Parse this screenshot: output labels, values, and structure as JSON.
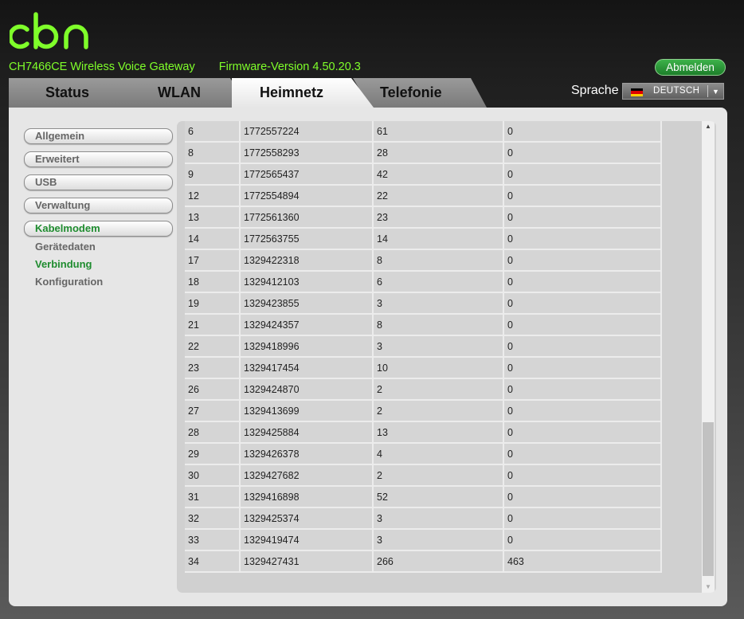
{
  "brand": {
    "logo_alt": "cbn",
    "logo_color": "#7fff2a"
  },
  "header": {
    "model": "CH7466CE  Wireless Voice Gateway",
    "firmware": "Firmware-Version  4.50.20.3",
    "logout_label": "Abmelden"
  },
  "tabs": [
    {
      "label": "Status",
      "active": false
    },
    {
      "label": "WLAN",
      "active": false
    },
    {
      "label": "Heimnetz",
      "active": true
    },
    {
      "label": "Telefonie",
      "active": false
    }
  ],
  "language": {
    "label": "Sprache",
    "selected": "DEUTSCH",
    "flag": "de-flag-icon"
  },
  "sidebar": {
    "items": [
      {
        "label": "Allgemein"
      },
      {
        "label": "Erweitert"
      },
      {
        "label": "USB"
      },
      {
        "label": "Verwaltung"
      },
      {
        "label": "Kabelmodem"
      }
    ],
    "subitems": [
      {
        "label": "Gerätedaten"
      },
      {
        "label": "Verbindung"
      },
      {
        "label": "Konfiguration"
      }
    ]
  },
  "table": {
    "rows": [
      [
        "6",
        "1772557224",
        "61",
        "0"
      ],
      [
        "8",
        "1772558293",
        "28",
        "0"
      ],
      [
        "9",
        "1772565437",
        "42",
        "0"
      ],
      [
        "12",
        "1772554894",
        "22",
        "0"
      ],
      [
        "13",
        "1772561360",
        "23",
        "0"
      ],
      [
        "14",
        "1772563755",
        "14",
        "0"
      ],
      [
        "17",
        "1329422318",
        "8",
        "0"
      ],
      [
        "18",
        "1329412103",
        "6",
        "0"
      ],
      [
        "19",
        "1329423855",
        "3",
        "0"
      ],
      [
        "21",
        "1329424357",
        "8",
        "0"
      ],
      [
        "22",
        "1329418996",
        "3",
        "0"
      ],
      [
        "23",
        "1329417454",
        "10",
        "0"
      ],
      [
        "26",
        "1329424870",
        "2",
        "0"
      ],
      [
        "27",
        "1329413699",
        "2",
        "0"
      ],
      [
        "28",
        "1329425884",
        "13",
        "0"
      ],
      [
        "29",
        "1329426378",
        "4",
        "0"
      ],
      [
        "30",
        "1329427682",
        "2",
        "0"
      ],
      [
        "31",
        "1329416898",
        "52",
        "0"
      ],
      [
        "32",
        "1329425374",
        "3",
        "0"
      ],
      [
        "33",
        "1329419474",
        "3",
        "0"
      ],
      [
        "34",
        "1329427431",
        "266",
        "463"
      ]
    ]
  },
  "colors": {
    "accent_green": "#7fff2a",
    "active_menu_green": "#1f8c2f",
    "logout_green": "#2e9e3c"
  }
}
